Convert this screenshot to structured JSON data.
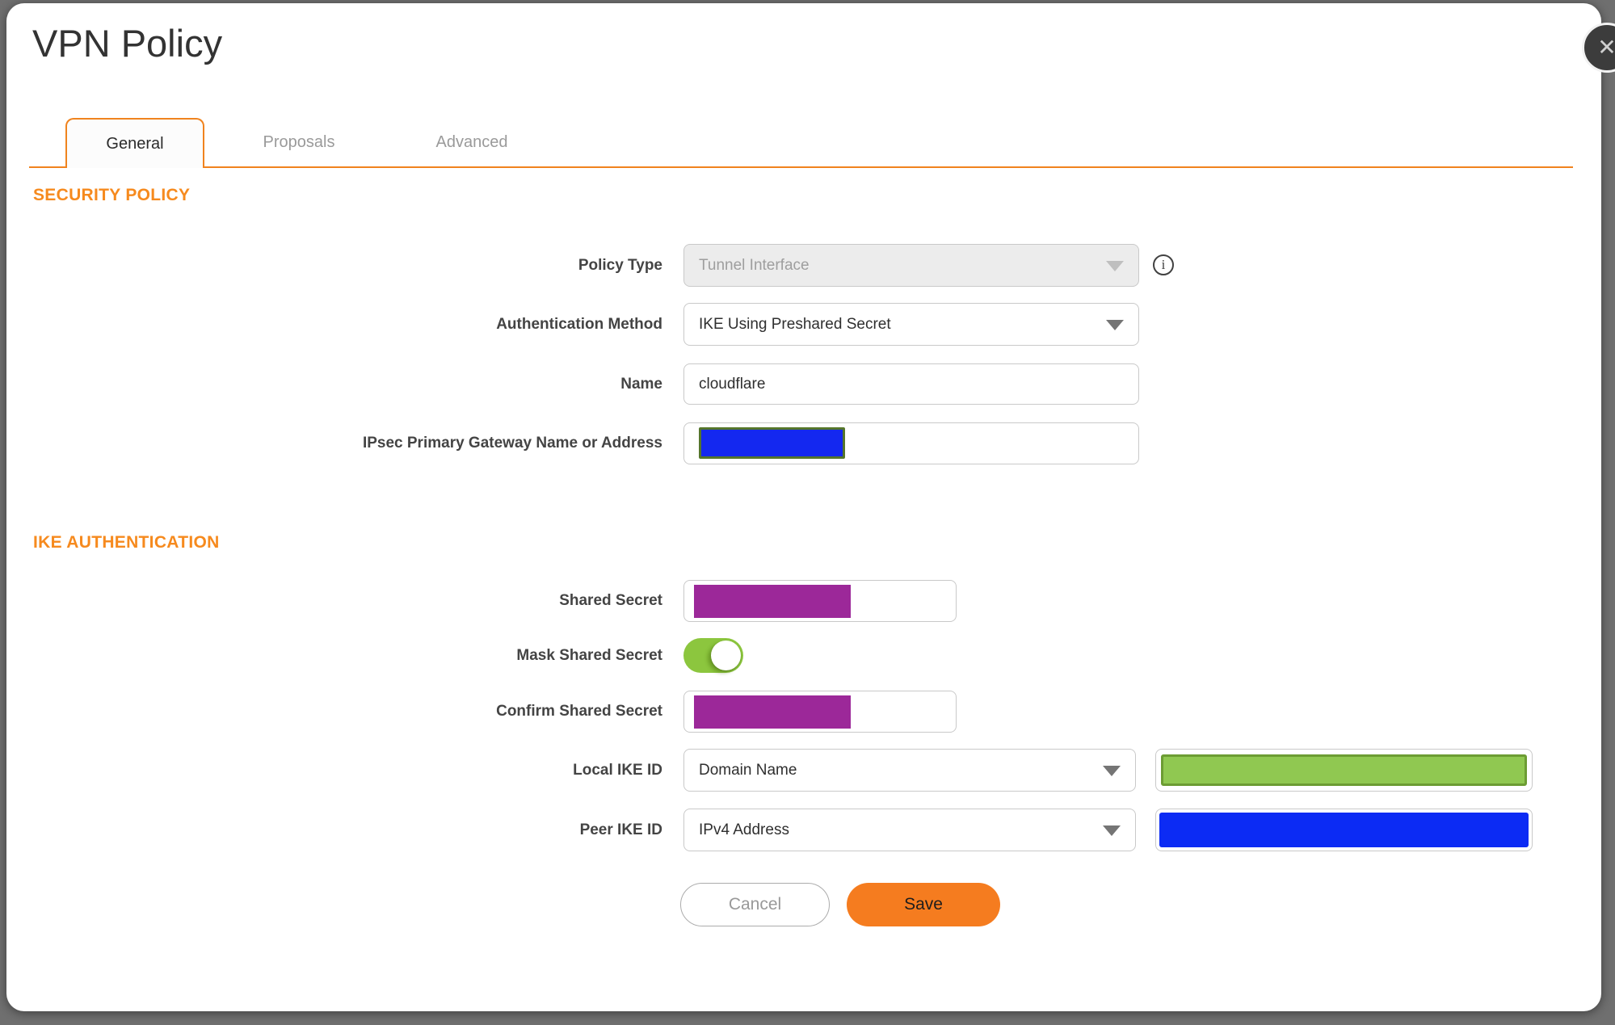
{
  "window": {
    "title": "VPN Policy"
  },
  "tabs": {
    "general": "General",
    "proposals": "Proposals",
    "advanced": "Advanced",
    "active_tab": "General"
  },
  "security_policy": {
    "heading": "SECURITY POLICY",
    "policy_type_label": "Policy Type",
    "policy_type_value": "Tunnel Interface",
    "policy_type_disabled": true,
    "auth_method_label": "Authentication Method",
    "auth_method_value": "IKE Using Preshared Secret",
    "name_label": "Name",
    "name_value": "cloudflare",
    "gateway_label": "IPsec Primary Gateway Name or Address",
    "gateway_value_redacted": true
  },
  "ike_authentication": {
    "heading": "IKE AUTHENTICATION",
    "shared_secret_label": "Shared Secret",
    "shared_secret_redacted": true,
    "mask_label": "Mask Shared Secret",
    "mask_on": true,
    "confirm_label": "Confirm Shared Secret",
    "confirm_redacted": true,
    "local_ike_label": "Local IKE ID",
    "local_ike_value": "Domain Name",
    "local_ike_value_redacted": true,
    "peer_ike_label": "Peer IKE ID",
    "peer_ike_value": "IPv4 Address",
    "peer_ike_value_redacted": true
  },
  "actions": {
    "cancel": "Cancel",
    "save": "Save"
  },
  "icons": {
    "close": "✕",
    "info": "i",
    "dropdown_arrow": "chevron-down",
    "toggle": "toggle-on"
  },
  "colors": {
    "accent_orange": "#F0831E",
    "section_orange": "#F68A1E",
    "save_orange": "#F57C1F",
    "toggle_green": "#8CC63E",
    "redaction_purple": "#9C2899",
    "redaction_blue": "#0C2BF4",
    "redaction_green_fill": "#90C851",
    "redaction_green_border": "#6C9C33",
    "backdrop_gray": "#6F6F6F"
  }
}
